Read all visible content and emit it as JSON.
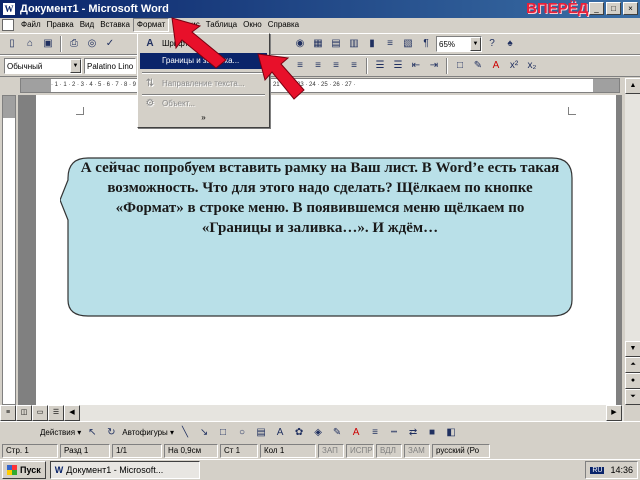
{
  "window": {
    "title": "Документ1 - Microsoft Word",
    "app_icon": "W",
    "overlay_label": "ВПЕРЁД>"
  },
  "menubar": {
    "items": [
      "Файл",
      "Правка",
      "Вид",
      "Вставка",
      "Формат",
      "Сервис",
      "Таблица",
      "Окно",
      "Справка"
    ]
  },
  "toolbar": {
    "zoom": "65%",
    "style": "Обычный",
    "font": "Palatino Lino"
  },
  "format_menu": {
    "items": [
      {
        "label": "Шрифт...",
        "icon": "font-icon",
        "state": "normal"
      },
      {
        "label": "Границы и заливка...",
        "icon": "",
        "state": "highlighted"
      },
      {
        "label": "Направление текста...",
        "icon": "text-direction-icon",
        "state": "disabled"
      },
      {
        "label": "Объект...",
        "icon": "object-icon",
        "state": "disabled"
      }
    ],
    "expand_glyph": "»"
  },
  "ruler_text": "· 1 · 1 · 2 · 3 · 4 · 5 · 6 · 7 · 8 · 9 · 10 · 11 · 12 · 13 · 14 · 15 · 16 · 17 · 18 · 19 · 20 · 21 · 22 · 23 · 24 · 25 · 26 · 27 ·",
  "callout": {
    "text": "А сейчас попробуем вставить рамку на Ваш лист. В Word’е есть такая возможность. Что для этого надо сделать? Щёлкаем по кнопке «Формат» в строке меню. В появившемся меню щёлкаем по «Границы и заливка…». И ждём…",
    "fill_color": "#b9e0e8",
    "border_color": "#333333"
  },
  "drawing_toolbar": {
    "actions_label": "Действия ▾",
    "autoshapes_label": "Автофигуры ▾"
  },
  "statusbar": {
    "page": "Стр. 1",
    "section": "Разд 1",
    "pages": "1/1",
    "at": "На 0,9см",
    "line": "Ст 1",
    "col": "Кол 1",
    "rec": "ЗАП",
    "trk": "ИСПР",
    "ext": "ВДЛ",
    "ovr": "ЗАМ",
    "language": "русский (Ро"
  },
  "taskbar": {
    "start_label": "Пуск",
    "task_label": "Документ1 - Microsoft...",
    "lang_indicator": "RU",
    "clock": "14:36"
  },
  "colors": {
    "arrow": "#e8102a",
    "titlebar": "#0a246a",
    "accent": "#e8203a"
  }
}
